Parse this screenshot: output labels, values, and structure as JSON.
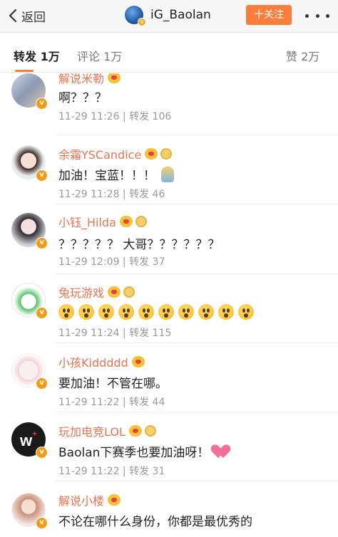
{
  "nav": {
    "back_label": "返回",
    "username": "iG_Baolan",
    "follow_label": "十关注"
  },
  "tabs": {
    "repost": "转发 1万",
    "comment": "评论 1万",
    "like": "赞 2万"
  },
  "colors": {
    "accent": "#fa7d3c",
    "name": "#eb7350",
    "meta": "#9a9a9a"
  },
  "comments": [
    {
      "name": "解说米勒",
      "text": "啊？？？",
      "meta": "11-29 11:26 | 转发 106"
    },
    {
      "name": "余霜YSCandice",
      "text": "加油！宝蓝！！！",
      "meta": "11-29 11:28 | 转发 46"
    },
    {
      "name": "小钰_Hilda",
      "text": "？？？？？ 大哥？？？？？？",
      "meta": "11-29 12:09 | 转发 37"
    },
    {
      "name": "兔玩游戏",
      "text": "",
      "meta": "11-29 11:24 | 转发 115"
    },
    {
      "name": "小孩Kiddddd",
      "text": "要加油！不管在哪。",
      "meta": "11-29 11:22 | 转发 44"
    },
    {
      "name": "玩加电竞LOL",
      "text": "Baolan下赛季也要加油呀！",
      "meta": "11-29 11:22 | 转发 31"
    },
    {
      "name": "解说小楼",
      "text": "不论在哪什么身份，你都是最优秀的",
      "meta": ""
    }
  ]
}
